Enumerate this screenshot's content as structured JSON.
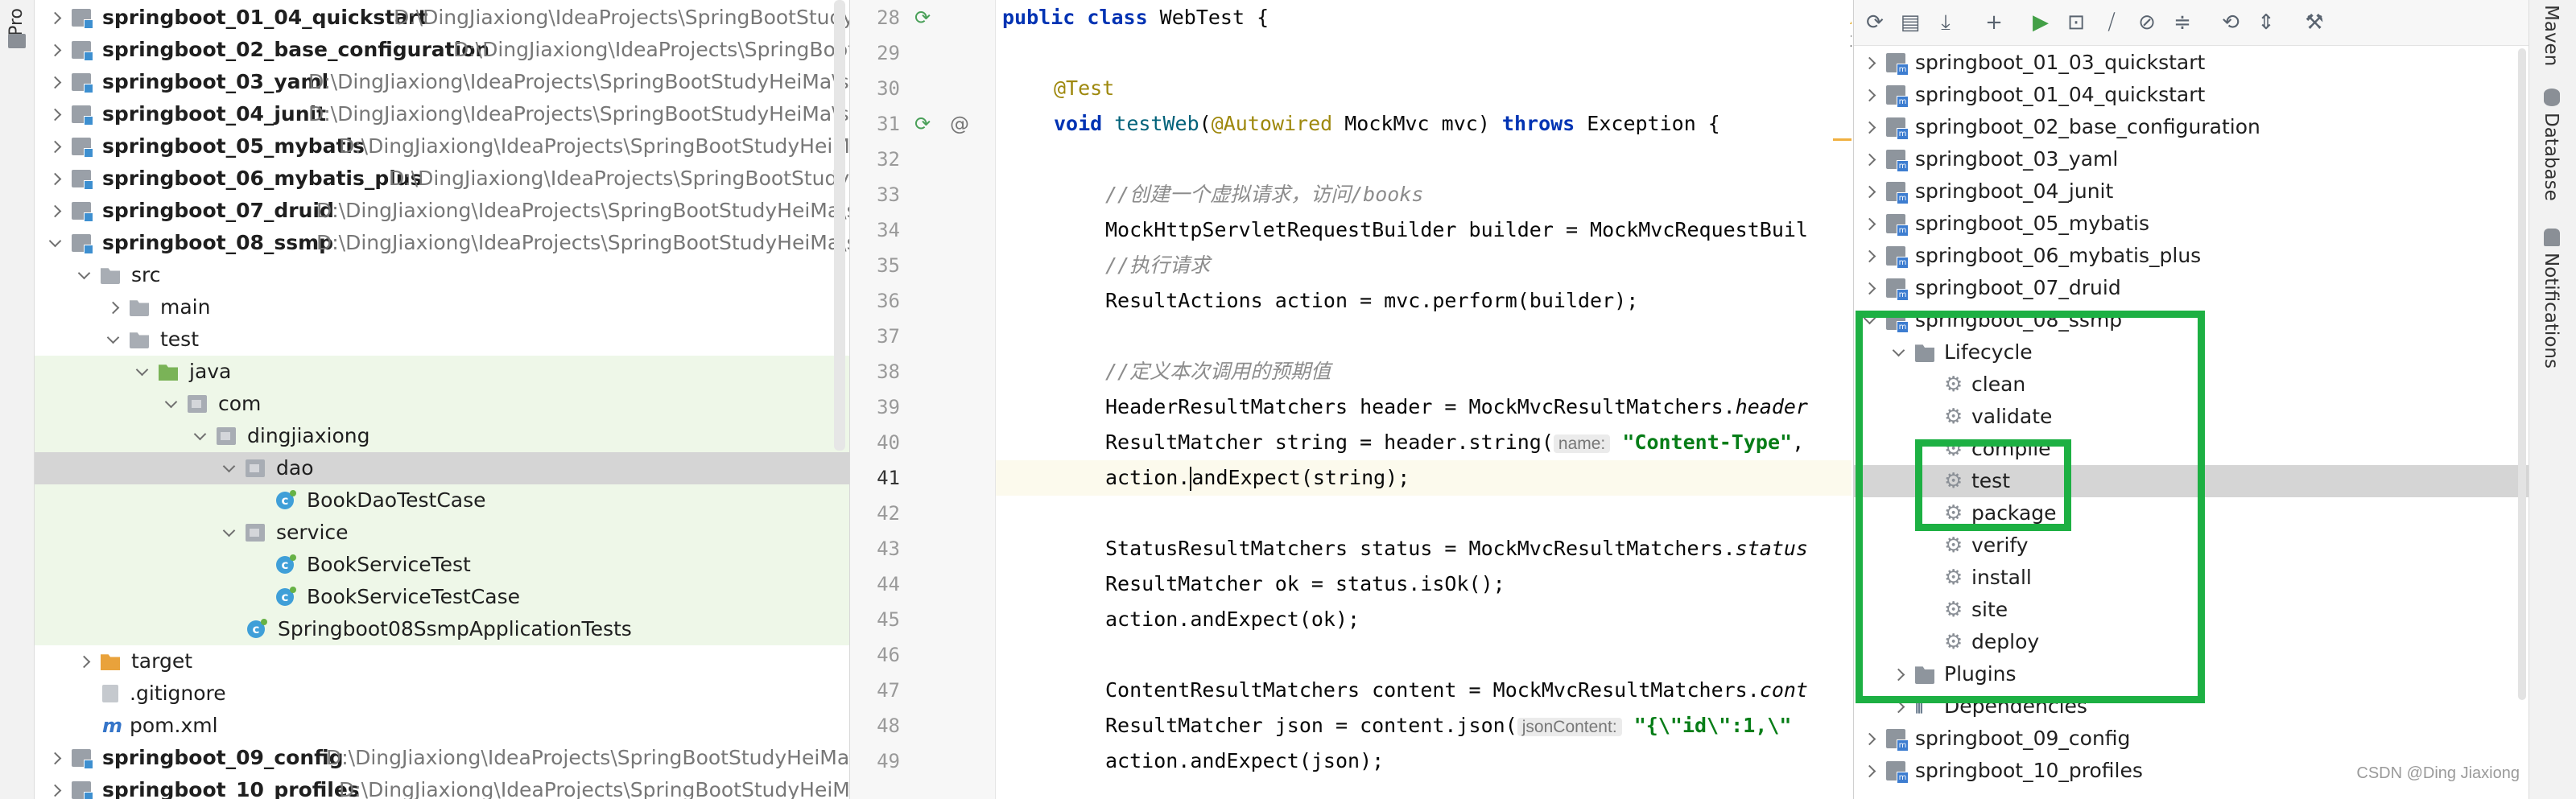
{
  "left_strip": {
    "label": "Pro"
  },
  "project_tree": {
    "rows": [
      {
        "name": "springboot_01_04_quickstart",
        "path": "D:\\DingJiaxiong\\IdeaProjects\\SpringBootStudyHeiMa\\sprin"
      },
      {
        "name": "springboot_02_base_configuration",
        "path": "D:\\DingJiaxiong\\IdeaProjects\\SpringBootStud"
      },
      {
        "name": "springboot_03_yaml",
        "path": "D:\\DingJiaxiong\\IdeaProjects\\SpringBootStudyHeiMa\\springbo"
      },
      {
        "name": "springboot_04_junit",
        "path": "D:\\DingJiaxiong\\IdeaProjects\\SpringBootStudyHeiMa\\springb"
      },
      {
        "name": "springboot_05_mybatis",
        "path": "D:\\DingJiaxiong\\IdeaProjects\\SpringBootStudyHeiMa\\spri"
      },
      {
        "name": "springboot_06_mybatis_plus",
        "path": "D:\\DingJiaxiong\\IdeaProjects\\SpringBootStudyHeiM"
      },
      {
        "name": "springboot_07_druid",
        "path": "D:\\DingJiaxiong\\IdeaProjects\\SpringBootStudyHeiMa\\sprin"
      },
      {
        "name": "springboot_08_ssmp",
        "path": "D:\\DingJiaxiong\\IdeaProjects\\SpringBootStudyHeiMa\\sprin"
      },
      {
        "name": "src"
      },
      {
        "name": "main"
      },
      {
        "name": "test"
      },
      {
        "name": "java"
      },
      {
        "name": "com"
      },
      {
        "name": "dingjiaxiong"
      },
      {
        "name": "dao"
      },
      {
        "name": "BookDaoTestCase"
      },
      {
        "name": "service"
      },
      {
        "name": "BookServiceTest"
      },
      {
        "name": "BookServiceTestCase"
      },
      {
        "name": "Springboot08SsmpApplicationTests"
      },
      {
        "name": "target"
      },
      {
        "name": ".gitignore"
      },
      {
        "name": "pom.xml"
      },
      {
        "name": "springboot_09_config",
        "path": "D:\\DingJiaxiong\\IdeaProjects\\SpringBootStudyHeiMa\\spri"
      },
      {
        "name": "springboot_10_profiles",
        "path": "D:\\DingJiaxiong\\IdeaProjects\\SpringBootStudyHeiMa\\s"
      }
    ]
  },
  "gutter": {
    "line_numbers": [
      "28",
      "29",
      "30",
      "31",
      "32",
      "33",
      "34",
      "35",
      "36",
      "37",
      "38",
      "39",
      "40",
      "41",
      "42",
      "43",
      "44",
      "45",
      "46",
      "47",
      "48",
      "49"
    ]
  },
  "editor": {
    "warning_count": "1",
    "lines": {
      "l28_kw": "public class ",
      "l28_rest": "WebTest {",
      "l30_an": "@Test",
      "l31_kw": "void ",
      "l31_m": "testWeb",
      "l31_p": "(",
      "l31_an": "@Autowired",
      "l31_r": " MockMvc mvc) ",
      "l31_kw2": "throws",
      "l31_e": " Exception {",
      "l33_cm": "//创建一个虚拟请求，访问/books",
      "l34": "MockHttpServletRequestBuilder builder = MockMvcRequestBuil",
      "l35_cm": "//执行请求",
      "l36": "ResultActions action = mvc.perform(builder);",
      "l38_cm": "//定义本次调用的预期值",
      "l39_a": "HeaderResultMatchers header = MockMvcResultMatchers.",
      "l39_i": "header",
      "l40_a": "ResultMatcher string = header.string(",
      "l40_h": "name:",
      "l40_s": "\"Content-Type\"",
      "l40_b": ",",
      "l41_a": "action.",
      "l41_b": "andExpect(string);",
      "l43_a": "StatusResultMatchers status = MockMvcResultMatchers.",
      "l43_i": "status",
      "l44": "ResultMatcher ok = status.isOk();",
      "l45": "action.andExpect(ok);",
      "l47_a": "ContentResultMatchers content = MockMvcResultMatchers.",
      "l47_i": "cont",
      "l48_a": "ResultMatcher json = content.json(",
      "l48_h": "jsonContent:",
      "l48_s": "\"{\\\"id\\\":1,\\\"",
      "l49": "action.andExpect(json);"
    }
  },
  "maven": {
    "toolbar_icons": [
      "reload-icon",
      "add-maven-project-icon",
      "download-icon",
      "plus-icon",
      "run-icon",
      "execute-goal-icon",
      "toggle-offline-icon",
      "skip-tests-icon",
      "collapse-icon",
      "show-dependencies-icon",
      "expand-icon",
      "settings-wrench-icon"
    ],
    "rows": [
      {
        "label": "springboot_01_03_quickstart"
      },
      {
        "label": "springboot_01_04_quickstart"
      },
      {
        "label": "springboot_02_base_configuration"
      },
      {
        "label": "springboot_03_yaml"
      },
      {
        "label": "springboot_04_junit"
      },
      {
        "label": "springboot_05_mybatis"
      },
      {
        "label": "springboot_06_mybatis_plus"
      },
      {
        "label": "springboot_07_druid"
      },
      {
        "label": "springboot_08_ssmp"
      },
      {
        "label": "Lifecycle"
      },
      {
        "label": "clean"
      },
      {
        "label": "validate"
      },
      {
        "label": "compile"
      },
      {
        "label": "test"
      },
      {
        "label": "package"
      },
      {
        "label": "verify"
      },
      {
        "label": "install"
      },
      {
        "label": "site"
      },
      {
        "label": "deploy"
      },
      {
        "label": "Plugins"
      },
      {
        "label": "Dependencies"
      },
      {
        "label": "springboot_09_config"
      },
      {
        "label": "springboot_10_profiles"
      }
    ],
    "highlight_color": "#1db043"
  },
  "right_strip": {
    "maven": "Maven",
    "database": "Database",
    "notifications": "Notifications"
  },
  "watermark": "CSDN @Ding Jiaxiong"
}
